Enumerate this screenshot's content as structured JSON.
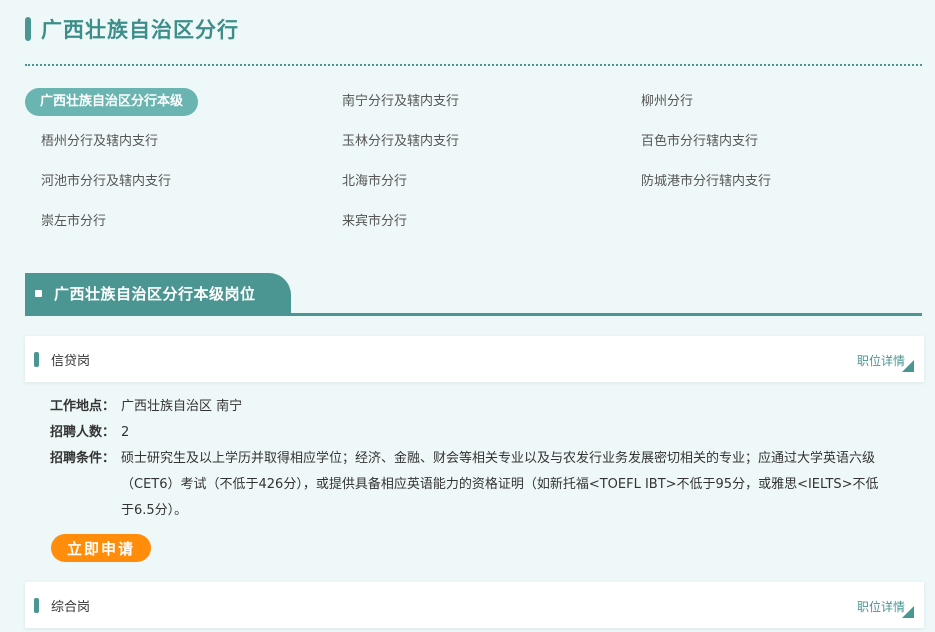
{
  "page": {
    "title": "广西壮族自治区分行"
  },
  "branches": [
    {
      "label": "广西壮族自治区分行本级",
      "active": true
    },
    {
      "label": "南宁分行及辖内支行"
    },
    {
      "label": "柳州分行"
    },
    {
      "label": "梧州分行及辖内支行"
    },
    {
      "label": "玉林分行及辖内支行"
    },
    {
      "label": "百色市分行辖内支行"
    },
    {
      "label": "河池市分行及辖内支行"
    },
    {
      "label": "北海市分行"
    },
    {
      "label": "防城港市分行辖内支行"
    },
    {
      "label": "崇左市分行"
    },
    {
      "label": "来宾市分行"
    }
  ],
  "section": {
    "title": "广西壮族自治区分行本级岗位"
  },
  "jobs": [
    {
      "title": "信贷岗",
      "detail_label": "职位详情",
      "location_label": "工作地点：",
      "location": "广西壮族自治区 南宁",
      "headcount_label": "招聘人数：",
      "headcount": "2",
      "requirements_label": "招聘条件：",
      "requirements": "硕士研究生及以上学历并取得相应学位；经济、金融、财会等相关专业以及与农发行业务发展密切相关的专业；应通过大学英语六级（CET6）考试（不低于426分），或提供具备相应英语能力的资格证明（如新托福<TOEFL IBT>不低于95分，或雅思<IELTS>不低于6.5分）。",
      "apply_label": "立即申请"
    },
    {
      "title": "综合岗",
      "detail_label": "职位详情"
    }
  ],
  "colors": {
    "primary": "#4b9692",
    "active_pill": "#6ab4b1",
    "apply": "#ff8c0a",
    "background": "#eef8f8"
  }
}
